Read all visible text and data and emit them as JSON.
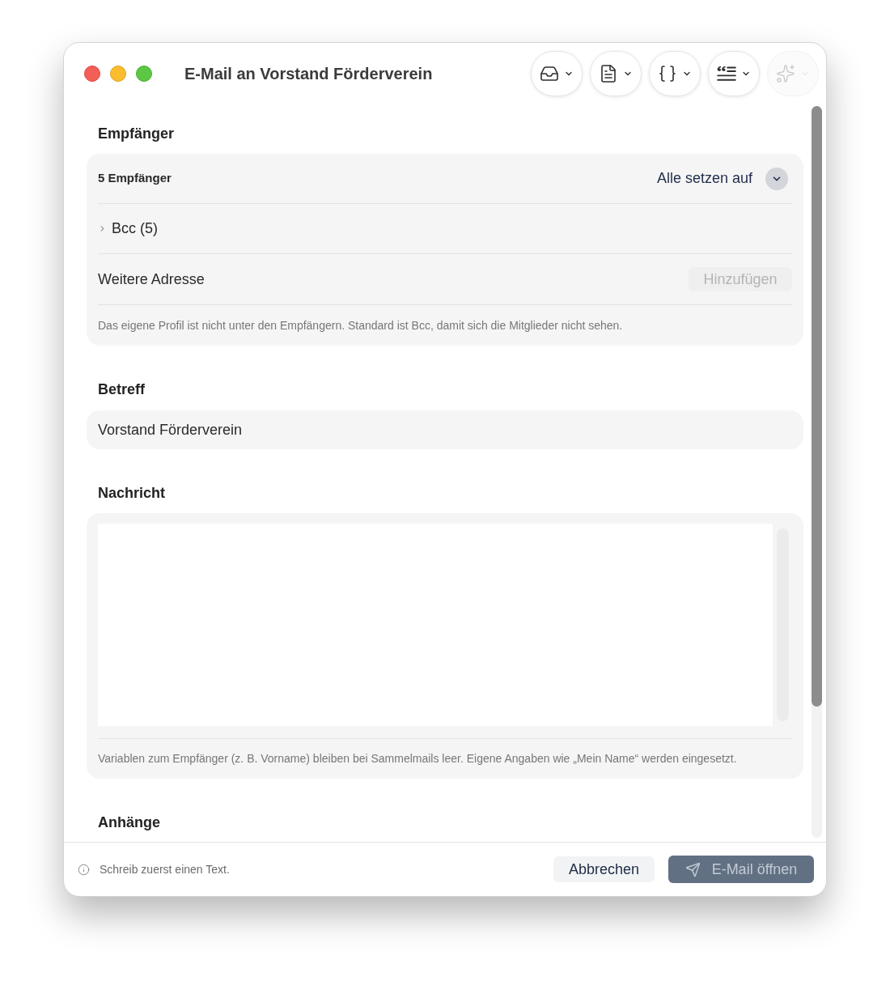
{
  "window": {
    "title": "E-Mail an Vorstand Förderverein"
  },
  "toolbar": [
    {
      "kind": "inbox",
      "disabled": false
    },
    {
      "kind": "document",
      "disabled": false
    },
    {
      "kind": "braces",
      "disabled": false
    },
    {
      "kind": "quote",
      "disabled": false
    },
    {
      "kind": "sparkles",
      "disabled": true
    }
  ],
  "recipients": {
    "heading": "Empfänger",
    "count": "5 Empfänger",
    "set_all": "Alle setzen auf",
    "bcc": {
      "label": "Bcc (5)",
      "expanded": false
    },
    "extra_address": {
      "label": "Weitere Adresse",
      "add_button": {
        "label": "Hinzufügen",
        "disabled": true
      }
    },
    "note": "Das eigene Profil ist nicht unter den Empfängern. Standard ist Bcc, damit sich die Mitglieder nicht sehen."
  },
  "subject": {
    "heading": "Betreff",
    "value": "Vorstand Förderverein"
  },
  "message": {
    "heading": "Nachricht",
    "note": "Variablen zum Empfänger (z. B. Vorname) bleiben bei Sammelmails leer. Eigene Angaben wie „Mein Name“ werden eingesetzt."
  },
  "attachments": {
    "heading": "Anhänge"
  },
  "footer": {
    "hint": "Schreib zuerst einen Text.",
    "cancel": "Abbrechen",
    "send": {
      "label": "E-Mail öffnen",
      "disabled": true
    }
  }
}
